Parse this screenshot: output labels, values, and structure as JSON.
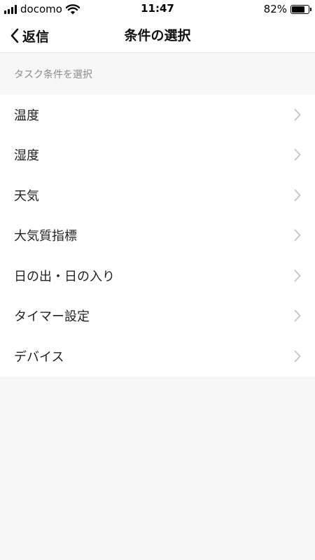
{
  "status_bar": {
    "carrier": "docomo",
    "time": "11:47",
    "battery_percent": "82%",
    "battery_level": 0.82,
    "signal_bars": 4
  },
  "nav": {
    "back_label": "返信",
    "title": "条件の選択"
  },
  "section": {
    "header": "タスク条件を選択"
  },
  "conditions": [
    {
      "label": "温度"
    },
    {
      "label": "湿度"
    },
    {
      "label": "天気"
    },
    {
      "label": "大気質指標"
    },
    {
      "label": "日の出・日の入り"
    },
    {
      "label": "タイマー設定"
    },
    {
      "label": "デバイス"
    }
  ]
}
